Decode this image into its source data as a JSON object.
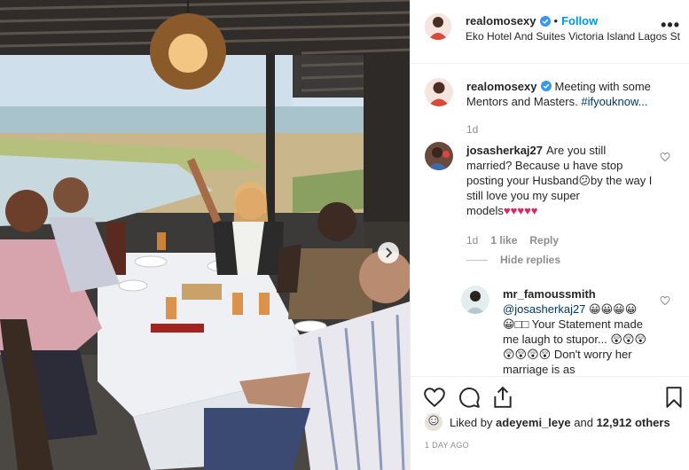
{
  "header": {
    "username": "realomosexy",
    "follow_label": "Follow",
    "separator": "•",
    "location": "Eko Hotel And Suites Victoria Island Lagos Sta...",
    "more_label": "•••"
  },
  "caption": {
    "username": "realomosexy",
    "text": "Meeting with some Mentors and Masters.",
    "hashtag": "#ifyouknow...",
    "time": "1d"
  },
  "comment1": {
    "username": "josasherkaj27",
    "text_part1": "Are you still married? Because u have stop posting your Husband",
    "emoji1": "😕",
    "text_part2": "by the way I still love you my super models",
    "hearts": "♥♥♥♥♥",
    "time": "1d",
    "likes": "1 like",
    "reply": "Reply"
  },
  "hide_replies": "Hide replies",
  "reply1": {
    "username": "mr_famoussmith",
    "mention": "@josasherkaj27",
    "emojis_a": "😀😀😀😀",
    "emojis_b": "😀□□",
    "text_a": "Your Statement made me laugh to stupor...",
    "emojis_c": "😲😲😲😲😲😲😲",
    "text_b": "Don't worry her marriage is as"
  },
  "likes": {
    "prefix": "Liked by",
    "user": "adeyemi_leye",
    "connector": "and",
    "count": "12,912 others"
  },
  "timestamp": "1 DAY AGO",
  "icons": {
    "like": "heart-icon",
    "comment": "comment-icon",
    "share": "share-icon",
    "save": "bookmark-icon",
    "verified": "verified-badge-icon"
  },
  "colors": {
    "link": "#0095f6",
    "hashtag": "#00376b",
    "muted": "#8e8e8e"
  }
}
